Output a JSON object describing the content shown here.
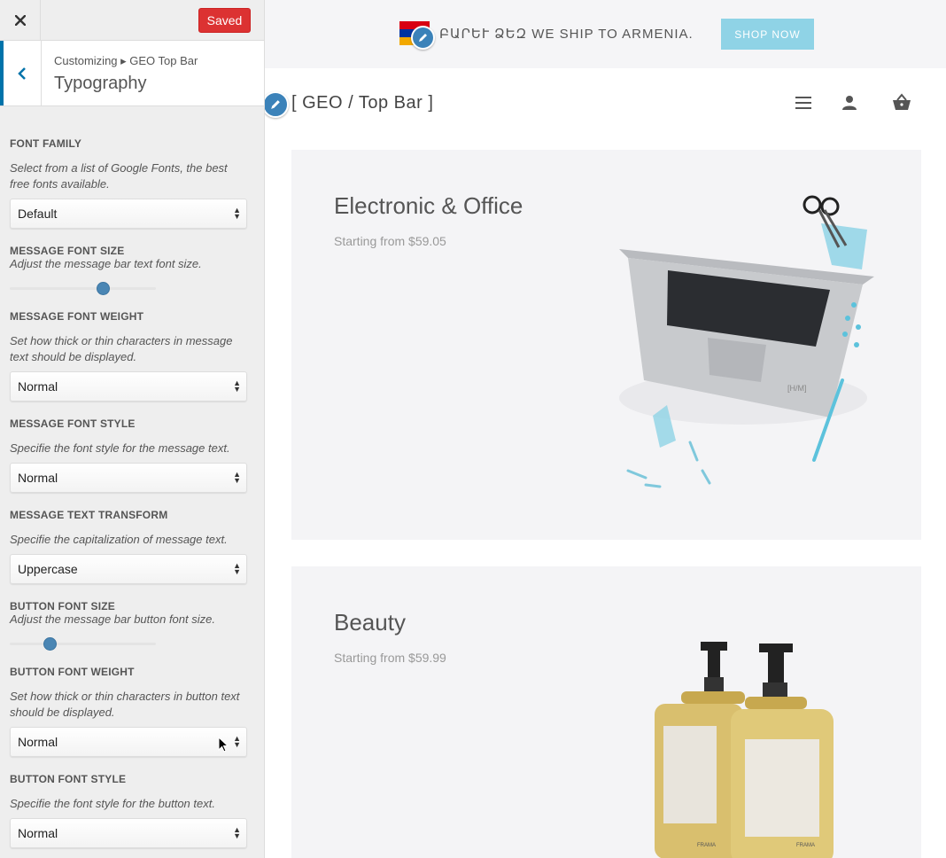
{
  "sidebar": {
    "close_icon": "close-icon",
    "saved_label": "Saved",
    "breadcrumb": "Customizing ▸ GEO Top Bar",
    "section_title": "Typography",
    "controls": {
      "font_family": {
        "label": "FONT FAMILY",
        "desc": "Select from a list of Google Fonts, the best free fonts available.",
        "value": "Default"
      },
      "message_font_size": {
        "label": "MESSAGE FONT SIZE",
        "desc": "Adjust the message bar text font size.",
        "level": 0.65
      },
      "message_font_weight": {
        "label": "MESSAGE FONT WEIGHT",
        "desc": "Set how thick or thin characters in message text should be displayed.",
        "value": "Normal"
      },
      "message_font_style": {
        "label": "MESSAGE FONT STYLE",
        "desc": "Specifie the font style for the message text.",
        "value": "Normal"
      },
      "message_text_transform": {
        "label": "MESSAGE TEXT TRANSFORM",
        "desc": "Specifie the capitalization of message text.",
        "value": "Uppercase"
      },
      "button_font_size": {
        "label": "BUTTON FONT SIZE",
        "desc": "Adjust the message bar button font size.",
        "level": 0.25
      },
      "button_font_weight": {
        "label": "BUTTON FONT WEIGHT",
        "desc": "Set how thick or thin characters in button text should be displayed.",
        "value": "Normal"
      },
      "button_font_style": {
        "label": "BUTTON FONT STYLE",
        "desc": "Specifie the font style for the button text.",
        "value": "Normal"
      }
    }
  },
  "preview": {
    "topbar": {
      "message": "ԲԱՐԵՒ ՁԵԶ WE SHIP TO ARMENIA.",
      "button_label": "SHOP NOW",
      "button_color": "#8fd3e6",
      "flag_colors": [
        "#d90012",
        "#0033a0",
        "#f2a800"
      ]
    },
    "site_title": "[ GEO / Top Bar ]",
    "header_icons": [
      "menu-icon",
      "user-icon",
      "basket-icon"
    ],
    "cards": [
      {
        "title": "Electronic & Office",
        "subtitle": "Starting from $59.05"
      },
      {
        "title": "Beauty",
        "subtitle": "Starting from $59.99"
      }
    ],
    "image_labels": {
      "laptop": "[H/M]",
      "bottle": "FRAMA"
    }
  },
  "colors": {
    "saved_button": "#dc3232",
    "accent": "#0073aa",
    "slider_thumb": "#4a86b4",
    "edit_shortcut": "#3b82b9"
  }
}
